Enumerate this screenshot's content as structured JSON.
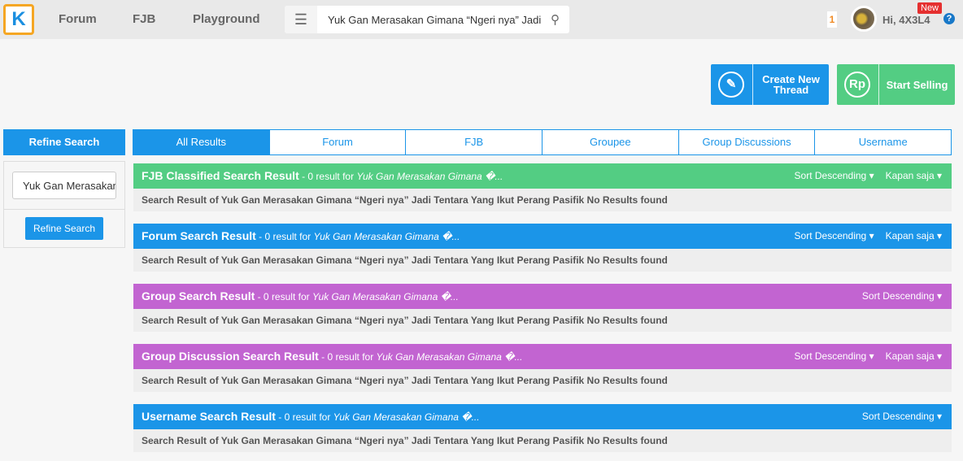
{
  "header": {
    "logo": "K",
    "nav": [
      "Forum",
      "FJB",
      "Playground"
    ],
    "search_value": "Yuk Gan Merasakan Gimana “Ngeri nya” Jadi",
    "notif_count": "1",
    "greeting": "Hi, 4X3L4",
    "new_badge": "New",
    "help": "?"
  },
  "actions": {
    "create_thread": "Create New Thread",
    "start_selling": "Start Selling",
    "rp_icon": "Rp"
  },
  "sidebar": {
    "title": "Refine Search",
    "input_value": "Yuk Gan Merasakan Gimana",
    "button": "Refine Search"
  },
  "tabs": [
    "All Results",
    "Forum",
    "FJB",
    "Groupee",
    "Group Discussions",
    "Username"
  ],
  "colors": {
    "blue": "#1b95e8",
    "green": "#53cd83",
    "purple": "#c264d1"
  },
  "sections": [
    {
      "title": "FJB Classified Search Result",
      "summary": " - 0 result for ",
      "query": "Yuk Gan Merasakan Gimana �...",
      "sort": "Sort Descending ▾",
      "time": "Kapan saja ▾",
      "body": "Search Result of Yuk Gan Merasakan Gimana “Ngeri nya” Jadi Tentara Yang Ikut Perang Pasifik No Results found"
    },
    {
      "title": "Forum Search Result",
      "summary": " - 0 result for ",
      "query": "Yuk Gan Merasakan Gimana �...",
      "sort": "Sort Descending ▾",
      "time": "Kapan saja ▾",
      "body": "Search Result of Yuk Gan Merasakan Gimana “Ngeri nya” Jadi Tentara Yang Ikut Perang Pasifik No Results found"
    },
    {
      "title": "Group Search Result",
      "summary": " - 0 result for ",
      "query": "Yuk Gan Merasakan Gimana �...",
      "sort": "Sort Descending ▾",
      "body": "Search Result of Yuk Gan Merasakan Gimana “Ngeri nya” Jadi Tentara Yang Ikut Perang Pasifik No Results found"
    },
    {
      "title": "Group Discussion Search Result",
      "summary": " - 0 result for ",
      "query": "Yuk Gan Merasakan Gimana �...",
      "sort": "Sort Descending ▾",
      "time": "Kapan saja ▾",
      "body": "Search Result of Yuk Gan Merasakan Gimana “Ngeri nya” Jadi Tentara Yang Ikut Perang Pasifik No Results found"
    },
    {
      "title": "Username Search Result",
      "summary": " - 0 result for ",
      "query": "Yuk Gan Merasakan Gimana �...",
      "sort": "Sort Descending ▾",
      "body": "Search Result of Yuk Gan Merasakan Gimana “Ngeri nya” Jadi Tentara Yang Ikut Perang Pasifik No Results found"
    }
  ]
}
